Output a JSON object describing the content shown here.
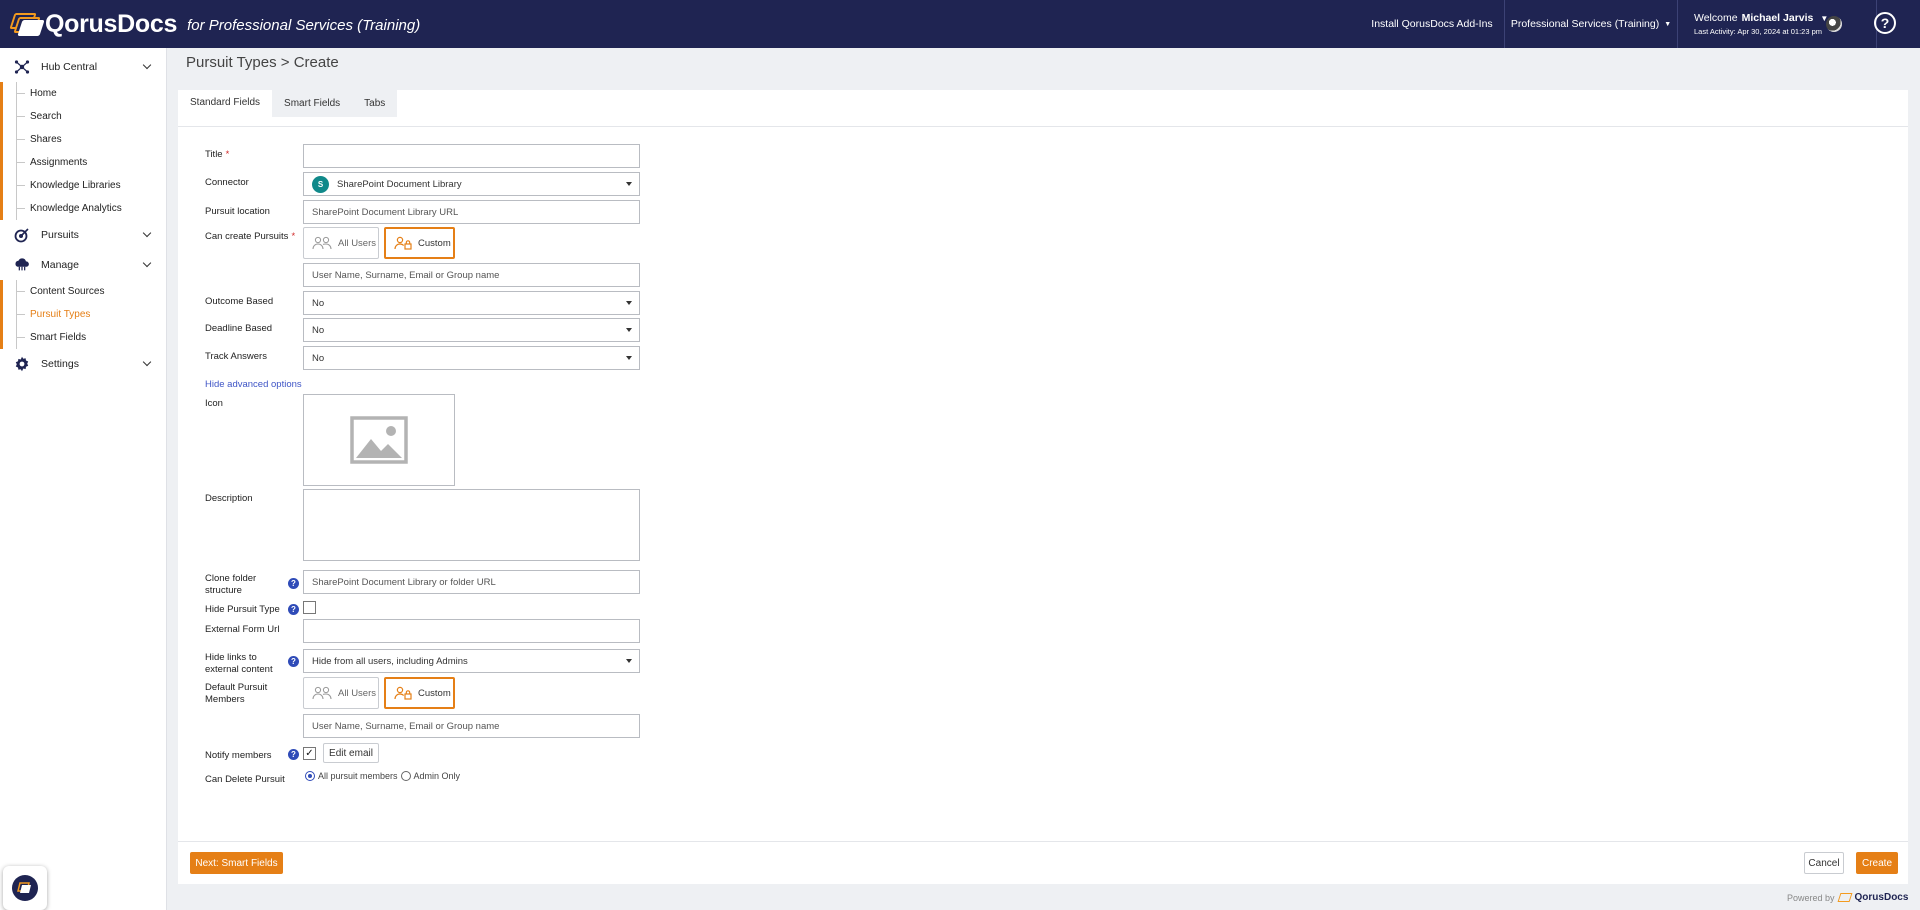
{
  "header": {
    "logo": "QorusDocs",
    "subtitle": "for Professional Services (Training)",
    "install_addins": "Install QorusDocs Add-Ins",
    "tenant": "Professional Services (Training)",
    "welcome_label": "Welcome",
    "user_name": "Michael Jarvis",
    "last_activity": "Last Activity: Apr 30, 2024 at 01:23 pm",
    "help_glyph": "?"
  },
  "sidebar": {
    "hub_central": "Hub Central",
    "hub_items": [
      "Home",
      "Search",
      "Shares",
      "Assignments",
      "Knowledge Libraries",
      "Knowledge Analytics"
    ],
    "pursuits": "Pursuits",
    "manage": "Manage",
    "manage_items": [
      "Content Sources",
      "Pursuit Types",
      "Smart Fields"
    ],
    "active_item": "Pursuit Types",
    "settings": "Settings",
    "collapse_glyph": "«"
  },
  "breadcrumb": "Pursuit Types > Create",
  "tabs": [
    "Standard Fields",
    "Smart Fields",
    "Tabs"
  ],
  "form": {
    "title_label": "Title",
    "required_mark": "*",
    "title_value": "",
    "connector_label": "Connector",
    "connector_value": "SharePoint Document Library",
    "location_label": "Pursuit location",
    "location_placeholder": "SharePoint Document Library URL",
    "can_create_label": "Can create Pursuits",
    "all_users": "All Users",
    "custom": "Custom",
    "user_placeholder": "User Name, Surname, Email or Group name",
    "outcome_label": "Outcome Based",
    "outcome_value": "No",
    "deadline_label": "Deadline Based",
    "deadline_value": "No",
    "track_label": "Track Answers",
    "track_value": "No",
    "advanced_link": "Hide advanced options",
    "icon_label": "Icon",
    "description_label": "Description",
    "clone_label": "Clone folder structure",
    "clone_placeholder": "SharePoint Document Library or folder URL",
    "hide_type_label": "Hide Pursuit Type",
    "external_url_label": "External Form Url",
    "hide_links_label": "Hide links to external content",
    "hide_links_value": "Hide from all users, including Admins",
    "default_members_label": "Default Pursuit Members",
    "notify_label": "Notify members",
    "notify_checked": true,
    "check_glyph": "✓",
    "edit_email": "Edit email",
    "can_delete_label": "Can Delete Pursuit",
    "delete_options": [
      "All pursuit members",
      "Admin Only"
    ],
    "delete_selected": "All pursuit members",
    "help_glyph": "?"
  },
  "footer": {
    "next_button": "Next: Smart Fields",
    "cancel_button": "Cancel",
    "create_button": "Create",
    "powered_by": "Powered by",
    "powered_brand": "QorusDocs"
  },
  "colors": {
    "header_bg": "#1f2452",
    "accent": "#e57f16",
    "link": "#3f55c6"
  }
}
